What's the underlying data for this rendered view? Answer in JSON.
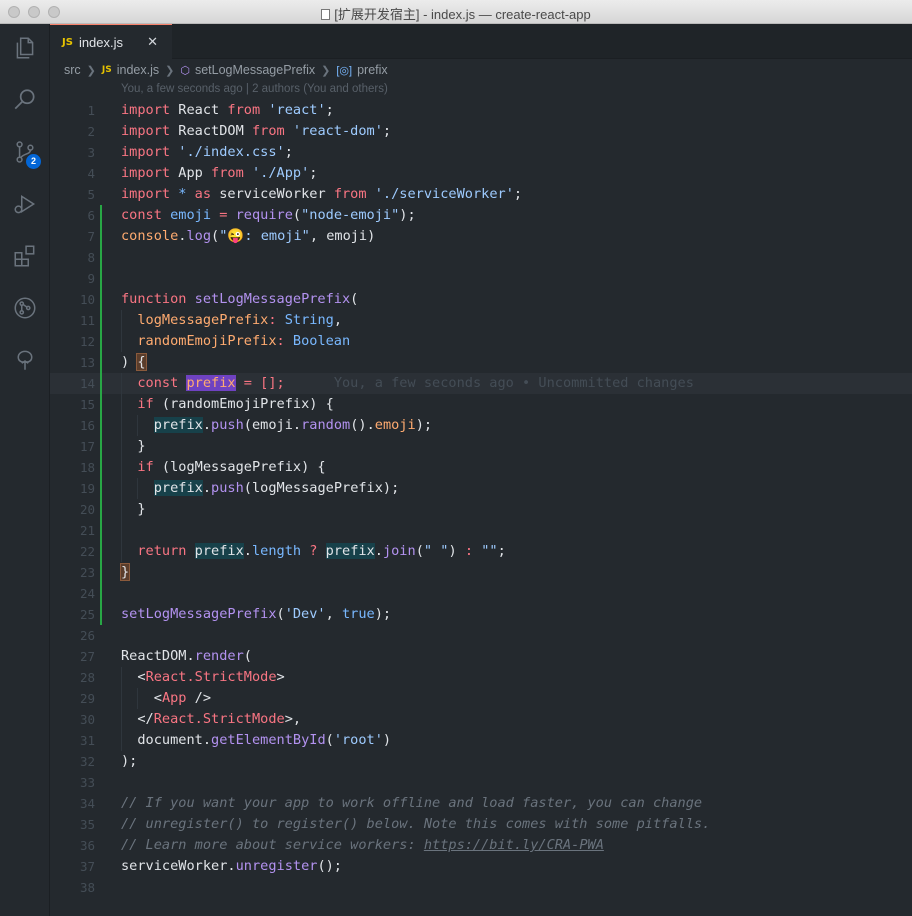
{
  "window": {
    "title": "[扩展开发宿主] - index.js — create-react-app"
  },
  "activity_bar": {
    "items": [
      {
        "name": "explorer-icon"
      },
      {
        "name": "search-icon"
      },
      {
        "name": "source-control-icon",
        "badge": "2"
      },
      {
        "name": "run-debug-icon"
      },
      {
        "name": "extensions-icon"
      },
      {
        "name": "git-graph-icon"
      },
      {
        "name": "tree-icon"
      }
    ]
  },
  "tab": {
    "icon_label": "JS",
    "label": "index.js",
    "close": "✕"
  },
  "breadcrumb": {
    "folder": "src",
    "file_icon": "JS",
    "file": "index.js",
    "function": "setLogMessagePrefix",
    "symbol": "prefix"
  },
  "codelens": "You, a few seconds ago | 2 authors (You and others)",
  "inline_blame": "You, a few seconds ago • Uncommitted changes",
  "line_numbers": [
    "1",
    "2",
    "3",
    "4",
    "5",
    "6",
    "7",
    "8",
    "9",
    "10",
    "11",
    "12",
    "13",
    "14",
    "15",
    "16",
    "17",
    "18",
    "19",
    "20",
    "21",
    "22",
    "23",
    "24",
    "25",
    "26",
    "27",
    "28",
    "29",
    "30",
    "31",
    "32",
    "33",
    "34",
    "35",
    "36",
    "37",
    "38"
  ],
  "code": {
    "l1": [
      "import",
      " React ",
      "from",
      " ",
      "'react'",
      ";"
    ],
    "l2": [
      "import",
      " ReactDOM ",
      "from",
      " ",
      "'react-dom'",
      ";"
    ],
    "l3": [
      "import",
      " ",
      "'./index.css'",
      ";"
    ],
    "l4": [
      "import",
      " App ",
      "from",
      " ",
      "'./App'",
      ";"
    ],
    "l5": [
      "import",
      " ",
      "*",
      " ",
      "as",
      " serviceWorker ",
      "from",
      " ",
      "'./serviceWorker'",
      ";"
    ],
    "l6": [
      "const",
      " ",
      "emoji",
      " = ",
      "require",
      "(",
      "\"node-emoji\"",
      ");"
    ],
    "l7": [
      "console",
      ".",
      "log",
      "(",
      "\"😜: emoji\"",
      ", emoji)"
    ],
    "l10": [
      "function",
      " ",
      "setLogMessagePrefix",
      "("
    ],
    "l11": [
      "logMessagePrefix",
      ": ",
      "String",
      ","
    ],
    "l12": [
      "randomEmojiPrefix",
      ": ",
      "Boolean"
    ],
    "l13": [
      ") ",
      "{"
    ],
    "l14": [
      "const",
      " ",
      "prefix",
      " = [];"
    ],
    "l15": [
      "if",
      " (randomEmojiPrefix) {"
    ],
    "l16": [
      "prefix",
      ".",
      "push",
      "(emoji.",
      "random",
      "().",
      "emoji",
      ");"
    ],
    "l17": [
      "}"
    ],
    "l18": [
      "if",
      " (logMessagePrefix) {"
    ],
    "l19": [
      "prefix",
      ".",
      "push",
      "(logMessagePrefix);"
    ],
    "l20": [
      "}"
    ],
    "l22": [
      "return",
      " ",
      "prefix",
      ".",
      "length",
      " ",
      "?",
      " ",
      "prefix",
      ".",
      "join",
      "(",
      "\" \"",
      ") ",
      ":",
      " ",
      "\"\"",
      ";"
    ],
    "l23": [
      "}"
    ],
    "l25": [
      "setLogMessagePrefix",
      "(",
      "'Dev'",
      ", ",
      "true",
      ");"
    ],
    "l27": [
      "ReactDOM",
      ".",
      "render",
      "("
    ],
    "l28": [
      "<",
      "React.StrictMode",
      ">"
    ],
    "l29": [
      "<",
      "App",
      " />"
    ],
    "l30": [
      "</",
      "React.StrictMode",
      ">,"
    ],
    "l31": [
      "document",
      ".",
      "getElementById",
      "(",
      "'root'",
      ")"
    ],
    "l32": [
      ");"
    ],
    "l34": [
      "// If you want your app to work offline and load faster, you can change"
    ],
    "l35": [
      "// unregister() to register() below. Note this comes with some pitfalls."
    ],
    "l36": [
      "// Learn more about service workers: ",
      "https://bit.ly/CRA-PWA"
    ],
    "l37": [
      "serviceWorker",
      ".",
      "unregister",
      "();"
    ]
  },
  "colors": {
    "editor_bg": "#24292e",
    "keyword": "#f97583",
    "string": "#9ecbff",
    "function": "#b392f0",
    "constant": "#79b8ff",
    "variable": "#ffab70",
    "tag": "#85e89d",
    "comment": "#6a737d",
    "added_gutter": "#28a745",
    "badge": "#0366d6"
  }
}
